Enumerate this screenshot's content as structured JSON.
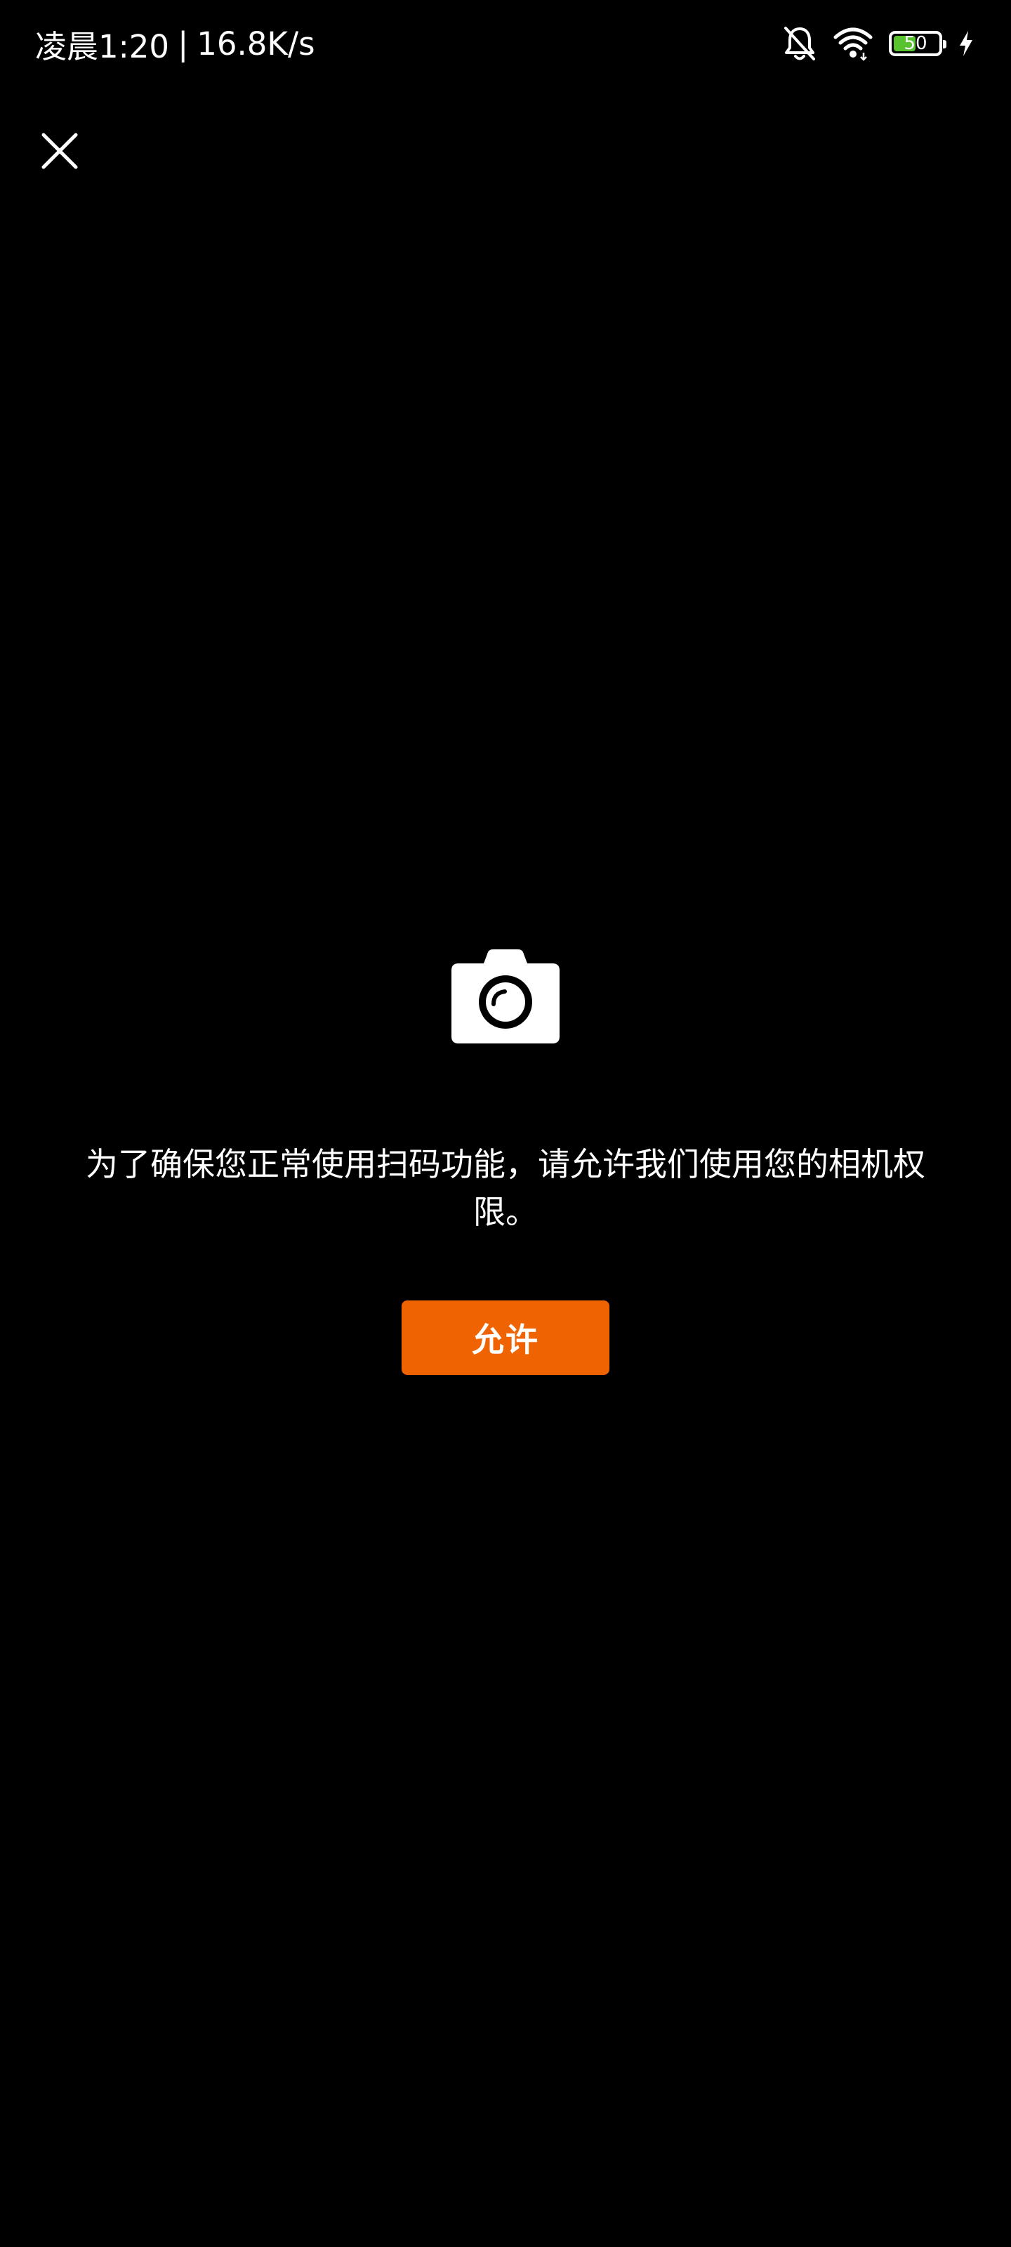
{
  "status_bar": {
    "time": "凌晨1:20",
    "separator": "|",
    "network_speed": "16.8K/s",
    "battery_level": "50",
    "battery_fraction": 0.5,
    "icons": [
      "bell-muted-icon",
      "wifi-icon",
      "battery-icon",
      "charging-bolt-icon"
    ],
    "battery_color": "#58c22f"
  },
  "header": {
    "close_icon": "close-icon"
  },
  "permission": {
    "icon": "camera-icon",
    "message": "为了确保您正常使用扫码功能，请允许我们使用您的相机权限。",
    "allow_label": "允许",
    "accent_color": "#f06302"
  }
}
